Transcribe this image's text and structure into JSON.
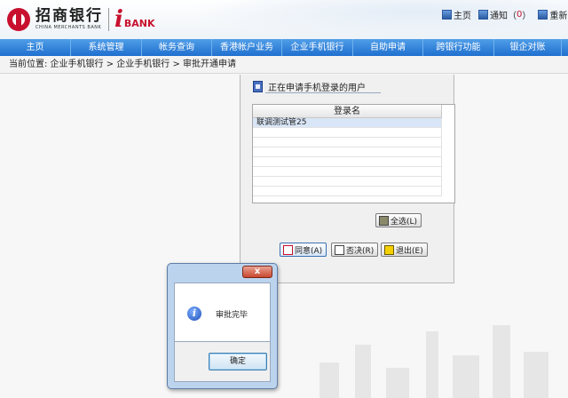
{
  "header": {
    "bank_name_cn": "招商银行",
    "bank_name_en": "CHINA MERCHANTS BANK",
    "ibank_i": "i",
    "ibank_text": "BANK",
    "toplinks": {
      "home": "主页",
      "notify": "通知",
      "notify_open": "（",
      "notify_count": "0",
      "notify_close": "）",
      "relogin": "重新"
    }
  },
  "nav": {
    "items": [
      "主页",
      "系统管理",
      "帐务查询",
      "香港帐户业务",
      "企业手机银行",
      "自助申请",
      "跨银行功能",
      "银企对账"
    ]
  },
  "breadcrumb": {
    "text": "当前位置:  企业手机银行 > 企业手机银行 > 审批开通申请"
  },
  "panel": {
    "section_title": "正在申请手机登录的用户",
    "grid": {
      "header": "登录名",
      "rows": [
        "联调测试管25"
      ]
    },
    "buttons": {
      "select_all": "全选(L)",
      "agree": "同意(A)",
      "reject": "否决(R)",
      "exit": "退出(E)"
    }
  },
  "dialog": {
    "close_glyph": "x",
    "info_glyph": "i",
    "message": "审批完毕",
    "ok_label": "确定"
  },
  "colors": {
    "brand_red": "#c8102e",
    "nav_blue": "#1f6fcf"
  }
}
